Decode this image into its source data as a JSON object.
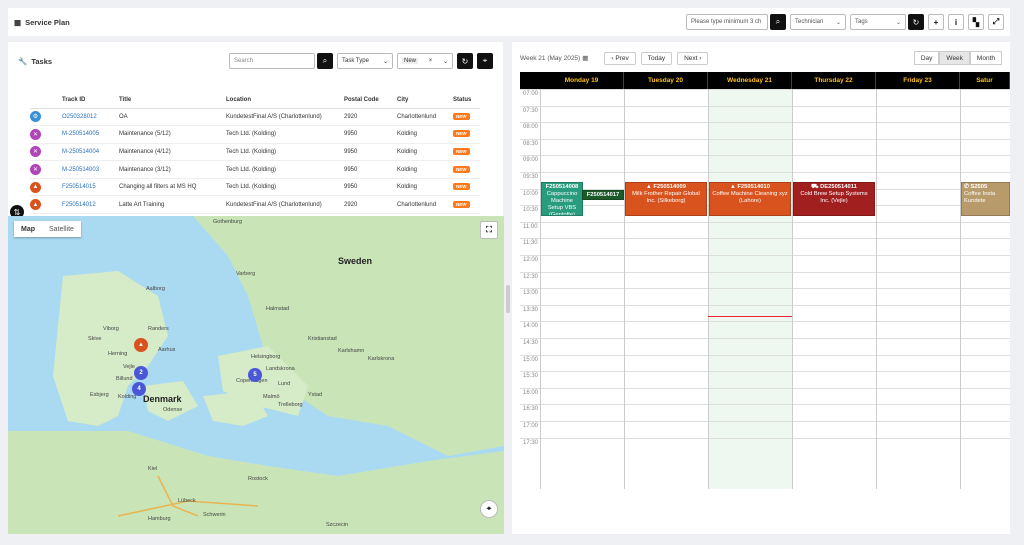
{
  "header": {
    "title": "Service Plan",
    "search_placeholder": "Please type minimum 3 ch",
    "technician": "Technician",
    "tags": "Tags"
  },
  "tasks": {
    "title": "Tasks",
    "search_placeholder": "Search",
    "task_type": "Task Type",
    "status_filter": "New",
    "columns": [
      "Track ID",
      "Title",
      "Location",
      "Postal Code",
      "City",
      "Status"
    ],
    "rows": [
      {
        "track_id": "O250328012",
        "title": "OA",
        "location": "KundetestFinal A/S (Charlottenlund)",
        "postal": "2920",
        "city": "Charlottenlund",
        "status": "NEW"
      },
      {
        "track_id": "M-250514005",
        "title": "Maintenance (5/12)",
        "location": "Tech Ltd. (Kolding)",
        "postal": "9950",
        "city": "Kolding",
        "status": "NEW"
      },
      {
        "track_id": "M-250514004",
        "title": "Maintenance (4/12)",
        "location": "Tech Ltd. (Kolding)",
        "postal": "9950",
        "city": "Kolding",
        "status": "NEW"
      },
      {
        "track_id": "M-250514003",
        "title": "Maintenance (3/12)",
        "location": "Tech Ltd. (Kolding)",
        "postal": "9950",
        "city": "Kolding",
        "status": "NEW"
      },
      {
        "track_id": "F250514015",
        "title": "Changing all filters at MS HQ",
        "location": "Tech Ltd. (Kolding)",
        "postal": "9950",
        "city": "Kolding",
        "status": "NEW"
      },
      {
        "track_id": "F250514012",
        "title": "Latte Art Training",
        "location": "KundetestFinal A/S (Charlottenlund)",
        "postal": "2920",
        "city": "Charlottenlund",
        "status": "NEW"
      }
    ]
  },
  "map": {
    "tab_map": "Map",
    "tab_satellite": "Satellite",
    "labels": [
      "Gothenburg",
      "Denmark",
      "Aalborg",
      "Aarhus",
      "Copenhagen",
      "Malmö",
      "Odense",
      "Billund",
      "Kolding",
      "Esbjerg",
      "Helsingborg",
      "Landskrona",
      "Lund",
      "Hamburg",
      "Kiel",
      "Lübeck",
      "Rostock",
      "Szczecin",
      "Schwerin",
      "Karlshamn",
      "Karlskrona",
      "Ystad",
      "Trelleborg",
      "Kristianstad",
      "Viborg",
      "Randers",
      "Skive",
      "Herning",
      "Vejle",
      "Halmstad",
      "Varberg",
      "Sweden"
    ],
    "cluster_counts": [
      "2",
      "4",
      "5"
    ]
  },
  "calendar": {
    "week_label": "Week 21 (May 2025)",
    "prev": "Prev",
    "today": "Today",
    "next": "Next",
    "views": [
      "Day",
      "Week",
      "Month"
    ],
    "days": [
      "Monday 19",
      "Tuesday 20",
      "Wednesday 21",
      "Thursday 22",
      "Friday 23",
      "Satur"
    ],
    "hours": [
      "07:00",
      "07:30",
      "08:00",
      "08:30",
      "09:00",
      "09:30",
      "10:00",
      "10:30",
      "11:00",
      "11:30",
      "12:00",
      "12:30",
      "13:00",
      "13:30",
      "14:00",
      "14:30",
      "15:00",
      "15:30",
      "16:00",
      "16:30",
      "17:00",
      "17:30"
    ],
    "events": [
      {
        "line1": "F250514008",
        "line2": "Cappuccino Machine Setup VBS (Gentofte)"
      },
      {
        "line1": "F250514017",
        "line2": ""
      },
      {
        "line1": "F250514009",
        "line2": "Milk Frother Repair Global Inc. (Silkeborg)"
      },
      {
        "line1": "F250514010",
        "line2": "Coffee Machine Cleaning xyz (Lahore)"
      },
      {
        "line1": "DE250514011",
        "line2": "Cold Brew Setup Systems Inc. (Vejle)"
      },
      {
        "line1": "S2505",
        "line2": "Coffee Insta Kundete"
      }
    ]
  }
}
